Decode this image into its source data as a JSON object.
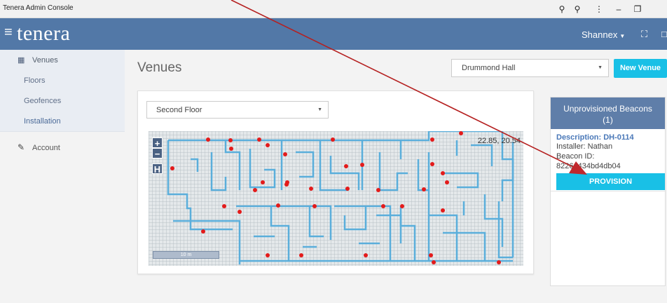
{
  "window": {
    "title": "Tenera Admin Console"
  },
  "header": {
    "brand": "tenera",
    "menu_icon": "hamburger-icon",
    "user": "Shannex"
  },
  "sidebar": {
    "items": [
      {
        "label": "Venues",
        "icon": "building-icon"
      },
      {
        "label": "Floors"
      },
      {
        "label": "Geofences"
      },
      {
        "label": "Installation"
      },
      {
        "label": "Account",
        "icon": "edit-icon"
      }
    ]
  },
  "main": {
    "title": "Venues",
    "venue_selected": "Drummond Hall",
    "new_venue_label": "New Venue",
    "floor_selected": "Second Floor"
  },
  "map": {
    "coords": "22.85, 20.54",
    "zoom_in": "+",
    "zoom_out": "−",
    "home": "H",
    "scale": "10 m"
  },
  "beacons": {
    "title": "Unprovisioned Beacons",
    "count": "(1)",
    "description": "Description: DH-0114",
    "installer": "Installer: Nathan",
    "beacon_id": "Beacon ID: 82261434bd4db04",
    "provision_label": "PROVISION"
  },
  "colors": {
    "header": "#5278a7",
    "accent": "#19c0e6",
    "wall": "#5aaedb",
    "beacon_dot": "#e31b1b",
    "annotation": "#b52020"
  }
}
